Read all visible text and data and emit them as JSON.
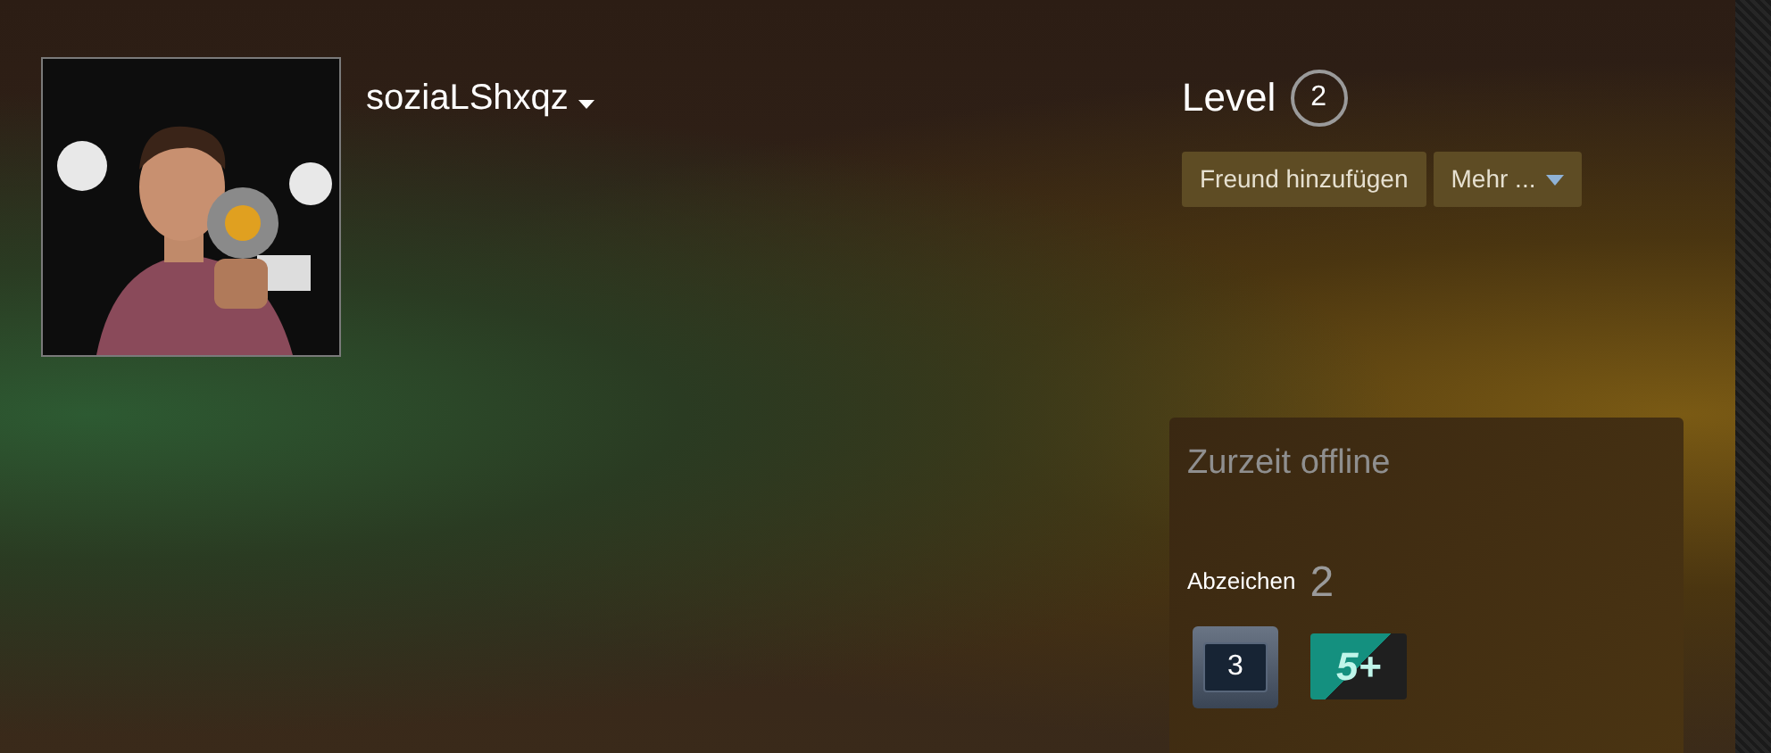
{
  "profile": {
    "persona_name": "soziaLShxqz",
    "level_label": "Level",
    "level": "2",
    "buttons": [
      {
        "label": "Freund hinzufügen",
        "dropdown": false
      },
      {
        "label": "Mehr ...",
        "dropdown": true
      }
    ]
  },
  "status_panel": {
    "status": "Zurzeit offline",
    "badges_label": "Abzeichen",
    "badges_count": "2",
    "badges": [
      {
        "kind": "years",
        "text": "3"
      },
      {
        "kind": "games",
        "text": "5+"
      }
    ]
  }
}
